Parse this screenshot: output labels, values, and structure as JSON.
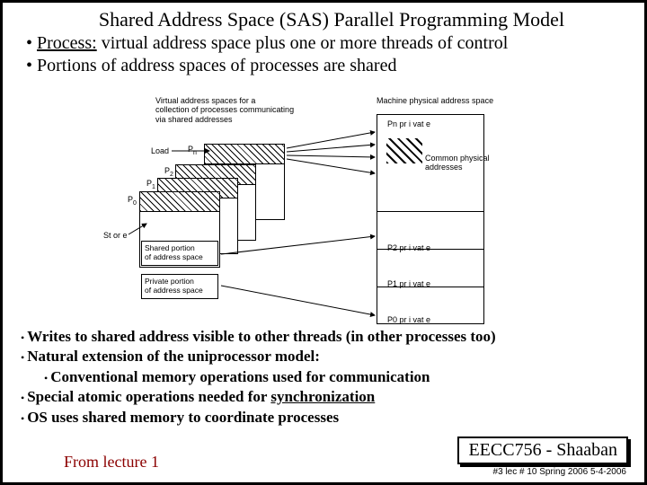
{
  "title": "Shared Address Space (SAS) Parallel Programming Model",
  "top_bullets": [
    {
      "prefix": "Process:",
      "rest": " virtual address space plus one or more threads of control"
    },
    {
      "prefix": "",
      "rest": "Portions of address spaces of processes are shared"
    }
  ],
  "diagram": {
    "vas_caption": "Virtual address spaces for a\ncollection of processes communicating\nvia shared addresses",
    "machine_caption": "Machine physical address space",
    "load_label": "Load",
    "store_label": "St or e",
    "p_labels": {
      "p0": "P0",
      "p1": "P1",
      "p2": "P2",
      "pn": "Pn"
    },
    "shared_portion": "Shared portion\nof address space",
    "private_portion": "Private portion\nof address space",
    "common_phys": "Common physical\naddresses",
    "priv_labels": {
      "pn": "Pn pr i vat e",
      "p2": "P2 pr i vat e",
      "p1": "P1 pr i vat e",
      "p0": "P0 pr i vat e"
    }
  },
  "bottom_bullets": [
    "Writes to shared address visible to other threads (in other processes too)",
    "Natural extension of the uniprocessor model:",
    "Conventional memory operations used for communication",
    "Special atomic operations needed for ",
    "OS uses shared memory to coordinate processes"
  ],
  "sync_word": "synchronization",
  "footer_box": "EECC756 - Shaaban",
  "footer_meta": "#3  lec # 10   Spring 2006  5-4-2006",
  "from_lecture": "From lecture 1"
}
